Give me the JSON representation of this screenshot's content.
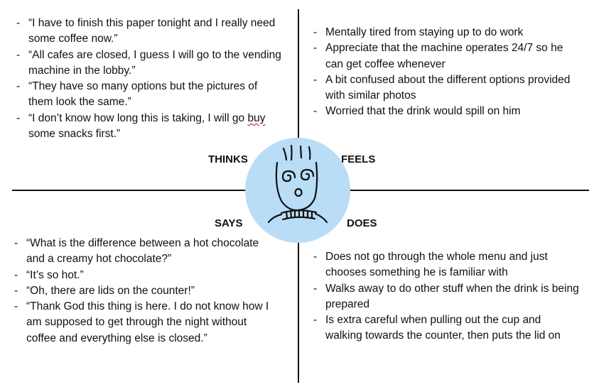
{
  "labels": {
    "thinks": "THINKS",
    "feels": "FEELS",
    "says": "SAYS",
    "does": "DOES"
  },
  "thinks": [
    "“I have to finish this paper tonight and I really need some coffee now.”",
    "“All cafes are closed, I guess I will go to the vending machine in the lobby.”",
    "“They have so many options but the pictures of them look the same.”",
    "“I don’t know how long this is taking, I will go buy some snacks first.”"
  ],
  "feels": [
    "Mentally tired from staying up to do work",
    "Appreciate that the machine operates 24/7 so he can get coffee whenever",
    "A bit confused about the different options provided with similar photos",
    "Worried that the drink would spill on him"
  ],
  "says": [
    "“What is the difference between a hot chocolate and a creamy hot chocolate?”",
    "“It’s so hot.”",
    "“Oh, there are lids on the counter!”",
    "“Thank God this thing is here. I do not know how I am supposed to get through the night without coffee and everything else is closed.”"
  ],
  "does": [
    "Does not go through the whole menu and just chooses something he is familiar with",
    "Walks away to do other stuff when the drink is being prepared",
    "Is extra careful when pulling out the cup and walking towards the counter, then puts the lid on"
  ],
  "colors": {
    "circle_fill": "#b9dcf7",
    "line": "#111111",
    "spell_squiggle": "#d0021b"
  },
  "icons": {
    "center": "face-sketch-icon"
  }
}
